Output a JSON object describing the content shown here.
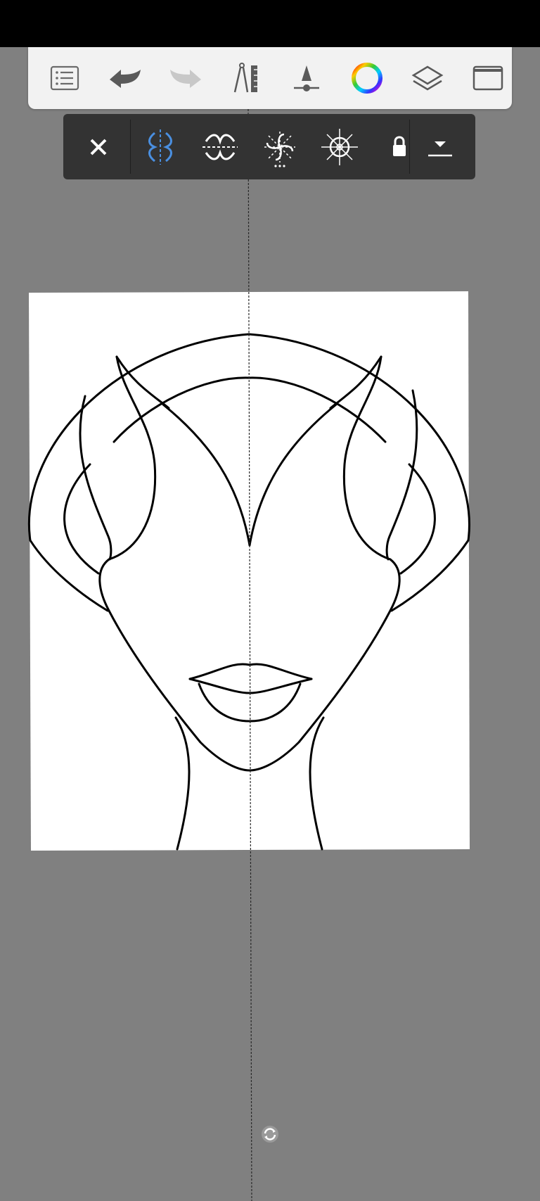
{
  "app": {
    "accent_color": "#4a8fe0",
    "toolbar_background": "#f2f2f2",
    "symmetry_toolbar_background": "#333333",
    "workspace_background": "#808080"
  },
  "main_toolbar": {
    "items": [
      {
        "name": "menu",
        "icon": "list-icon"
      },
      {
        "name": "undo",
        "icon": "undo-arrow-icon"
      },
      {
        "name": "redo",
        "icon": "redo-arrow-icon",
        "disabled": true
      },
      {
        "name": "guides",
        "icon": "compass-ruler-icon"
      },
      {
        "name": "brush-properties",
        "icon": "brush-cone-icon"
      },
      {
        "name": "color",
        "icon": "color-wheel-icon"
      },
      {
        "name": "layers",
        "icon": "layers-icon"
      },
      {
        "name": "fullscreen",
        "icon": "frame-icon"
      }
    ]
  },
  "symmetry_toolbar": {
    "items": [
      {
        "name": "close",
        "icon": "close-icon"
      },
      {
        "name": "vertical-symmetry",
        "icon": "vertical-symmetry-icon",
        "selected": true
      },
      {
        "name": "horizontal-symmetry",
        "icon": "horizontal-symmetry-icon"
      },
      {
        "name": "rotary-symmetry",
        "icon": "rotary-symmetry-icon"
      },
      {
        "name": "radial-symmetry",
        "icon": "radial-symmetry-icon"
      },
      {
        "name": "lock",
        "icon": "lock-icon"
      },
      {
        "name": "options",
        "icon": "dropdown-icon"
      }
    ]
  },
  "canvas": {
    "symmetry_axis": "vertical",
    "drawing": "line-art-face-with-headpiece"
  }
}
